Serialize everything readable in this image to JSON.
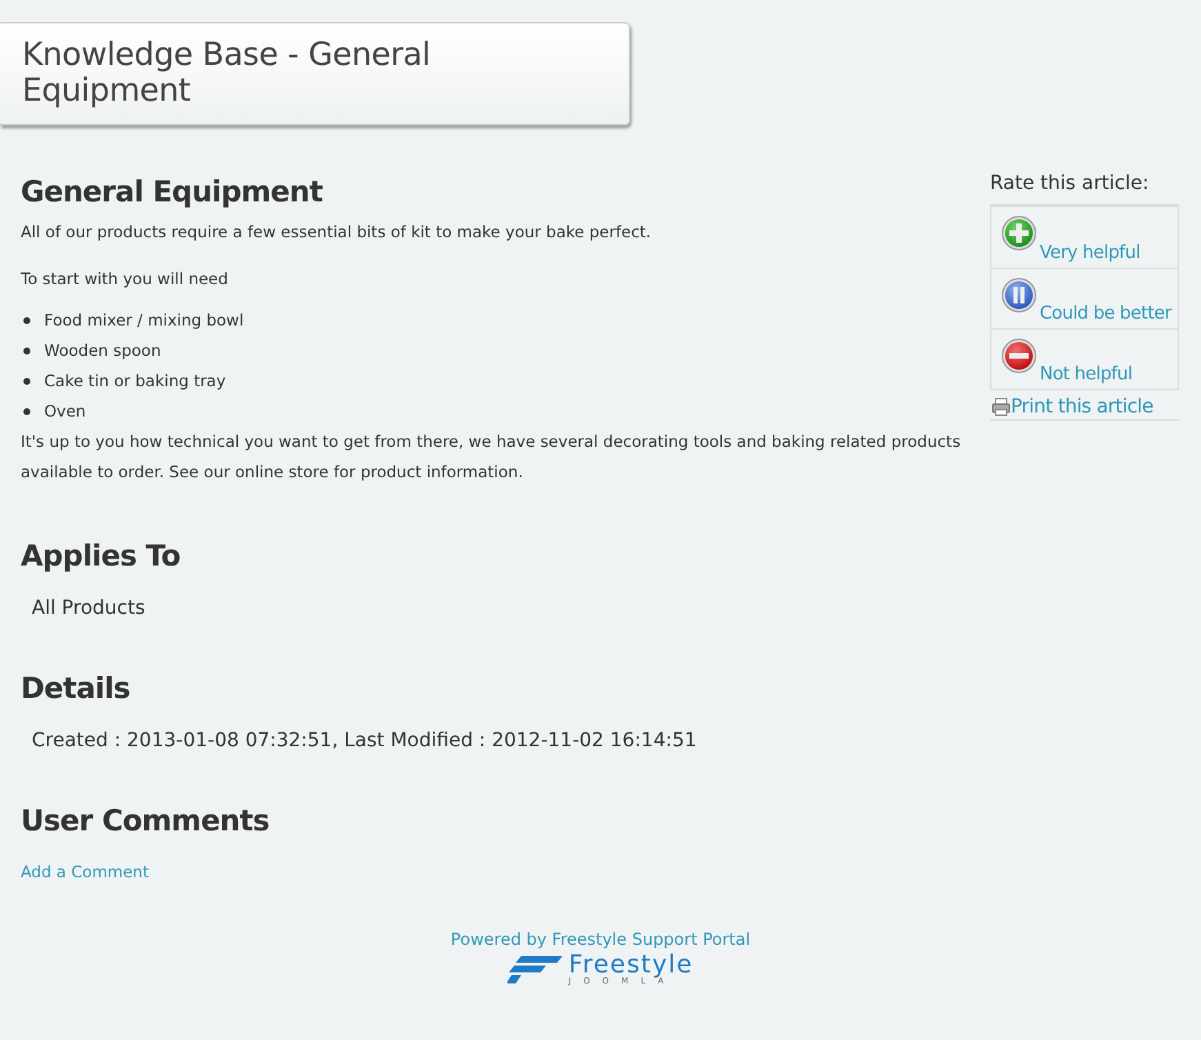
{
  "page_title": "Knowledge Base - General Equipment",
  "article": {
    "heading": "General Equipment",
    "paragraphs_before": [
      "All of our products require a few essential bits of kit to make your bake perfect.",
      "To start with you will need"
    ],
    "list": [
      "Food mixer / mixing bowl",
      "Wooden spoon",
      "Cake tin or baking tray",
      "Oven"
    ],
    "paragraph_after": "It's up to you how technical you want to get from there, we have several decorating tools and baking related products available to order. See our online store for product information."
  },
  "rating": {
    "label": "Rate this article:",
    "options": [
      {
        "kind": "plus",
        "label": "Very helpful"
      },
      {
        "kind": "pause",
        "label": "Could be better"
      },
      {
        "kind": "minus",
        "label": "Not helpful"
      }
    ],
    "print_link": "Print this article"
  },
  "applies_to": {
    "heading": "Applies To",
    "value": "All Products"
  },
  "details": {
    "heading": "Details",
    "value": "Created : 2013-01-08 07:32:51, Last Modified : 2012-11-02 16:14:51"
  },
  "comments": {
    "heading": "User Comments",
    "link": "Add a Comment"
  },
  "footer": {
    "powered_by": "Powered by Freestyle Support Portal",
    "logo_word": "Freestyle",
    "logo_sub": "JOOMLA"
  }
}
